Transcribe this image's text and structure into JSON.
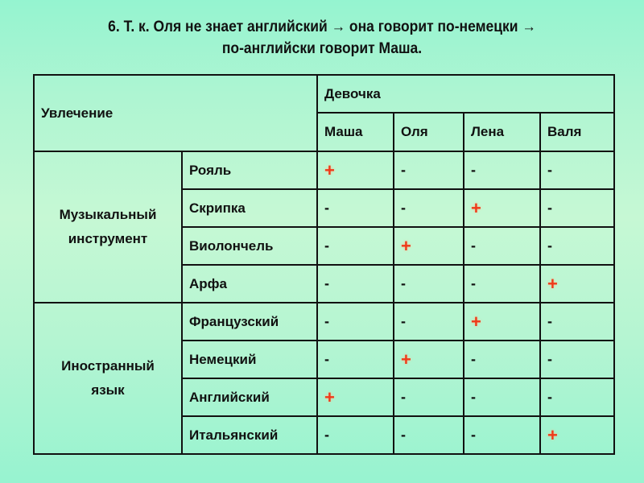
{
  "title": {
    "line1": "6. Т. к. Оля не знает английский → она говорит по-немецки →",
    "line2": "по-английски говорит Маша."
  },
  "table": {
    "corner_header": "Увлечение",
    "girls_header": "Девочка",
    "girls": [
      "Маша",
      "Оля",
      "Лена",
      "Валя"
    ],
    "groups": [
      {
        "label_line1": "Музыкальный",
        "label_line2": "инструмент",
        "rows": [
          {
            "item": "Рояль",
            "marks": [
              "+",
              "-",
              "-",
              "-"
            ]
          },
          {
            "item": "Скрипка",
            "marks": [
              "-",
              "-",
              "+",
              "-"
            ]
          },
          {
            "item": "Виолончель",
            "marks": [
              "-",
              "+",
              "-",
              "-"
            ]
          },
          {
            "item": "Арфа",
            "marks": [
              "-",
              "-",
              "-",
              "+"
            ]
          }
        ]
      },
      {
        "label_line1": "Иностранный",
        "label_line2": "язык",
        "rows": [
          {
            "item": "Французский",
            "marks": [
              "-",
              "-",
              "+",
              "-"
            ]
          },
          {
            "item": "Немецкий",
            "marks": [
              "-",
              "+",
              "-",
              "-"
            ]
          },
          {
            "item": "Английский",
            "marks": [
              "+",
              "-",
              "-",
              "-"
            ]
          },
          {
            "item": "Итальянский",
            "marks": [
              "-",
              "-",
              "-",
              "+"
            ]
          }
        ]
      }
    ]
  }
}
